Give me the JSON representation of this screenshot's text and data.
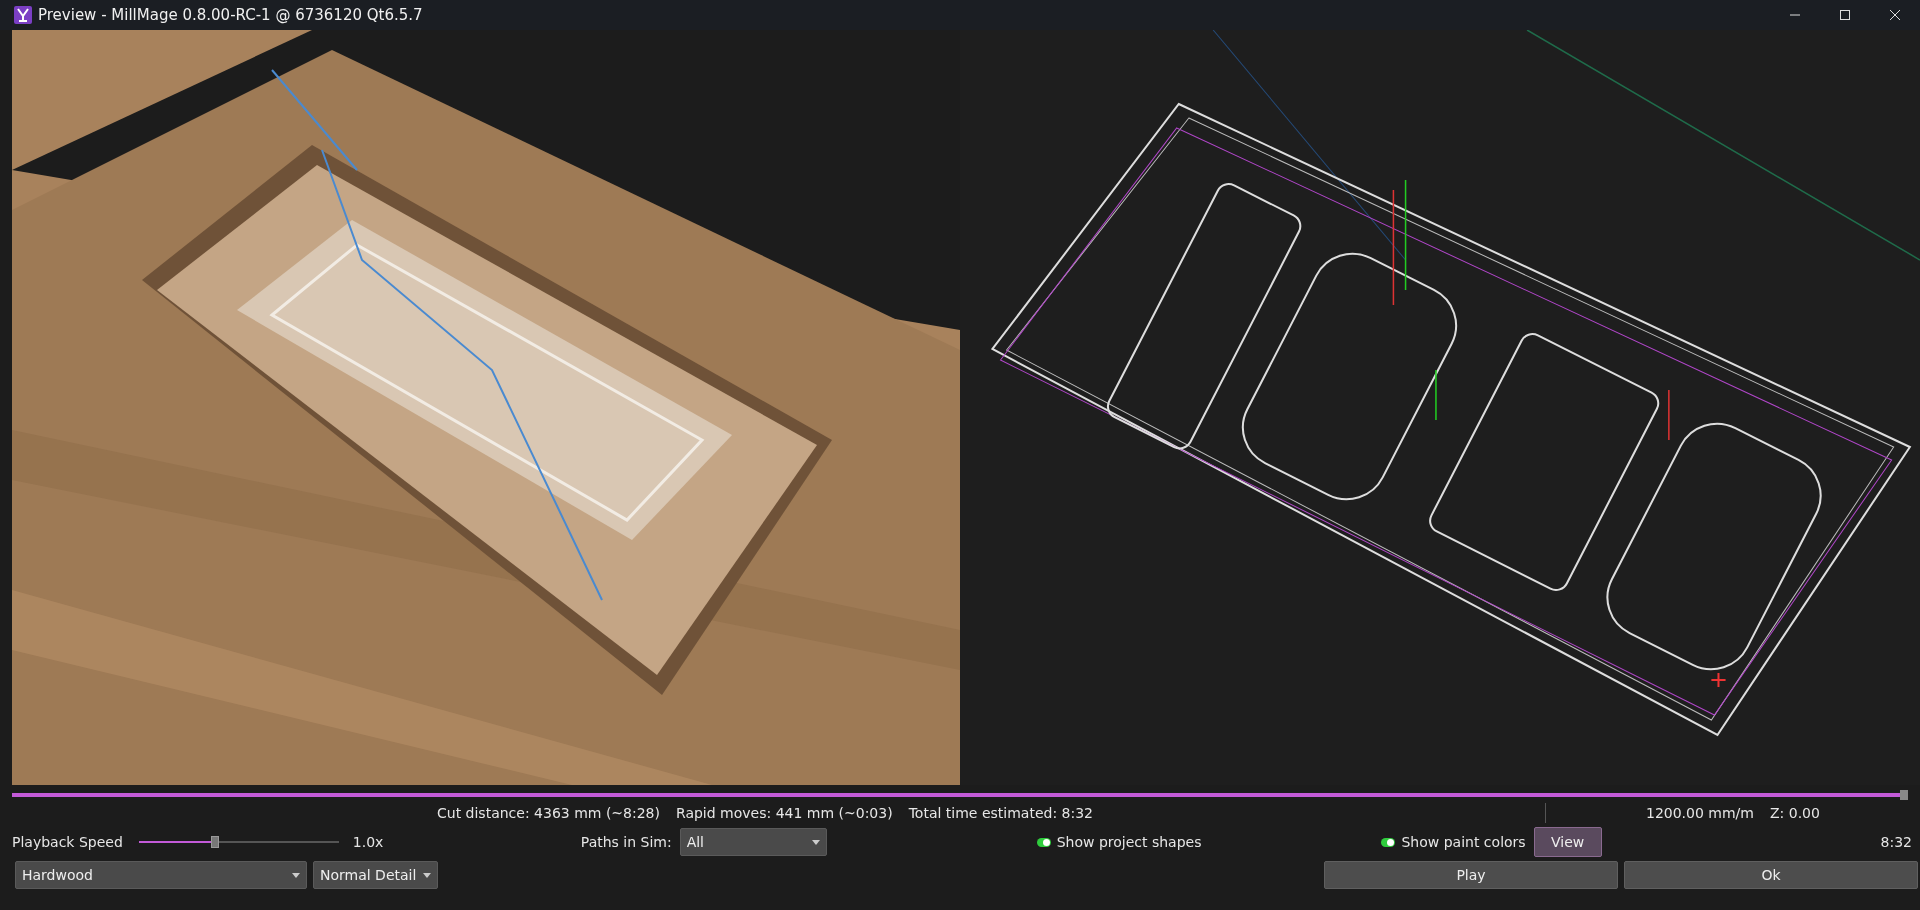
{
  "window": {
    "title": "Preview - MillMage 0.8.00-RC-1 @ 6736120 Qt6.5.7"
  },
  "progress": {
    "level": 1
  },
  "stats": {
    "cut_distance": "Cut distance: 4363 mm (~8:28)",
    "rapid_moves": "Rapid moves: 441 mm (~0:03)",
    "total_time": "Total time estimated: 8:32",
    "feed_rate": "1200.00 mm/m",
    "z": "Z: 0.00"
  },
  "playback": {
    "label": "Playback Speed",
    "level": 0.38,
    "reading": "1.0x"
  },
  "paths_in_sim": {
    "label": "Paths in Sim:",
    "value": "All"
  },
  "toggles": [
    {
      "label": "Show project shapes",
      "on": true
    },
    {
      "label": "Show paint colors",
      "on": true
    }
  ],
  "view_button": "View",
  "time": "8:32",
  "material": "Hardwood",
  "detail": "Normal Detail",
  "buttons": [
    "Play",
    "Ok"
  ]
}
